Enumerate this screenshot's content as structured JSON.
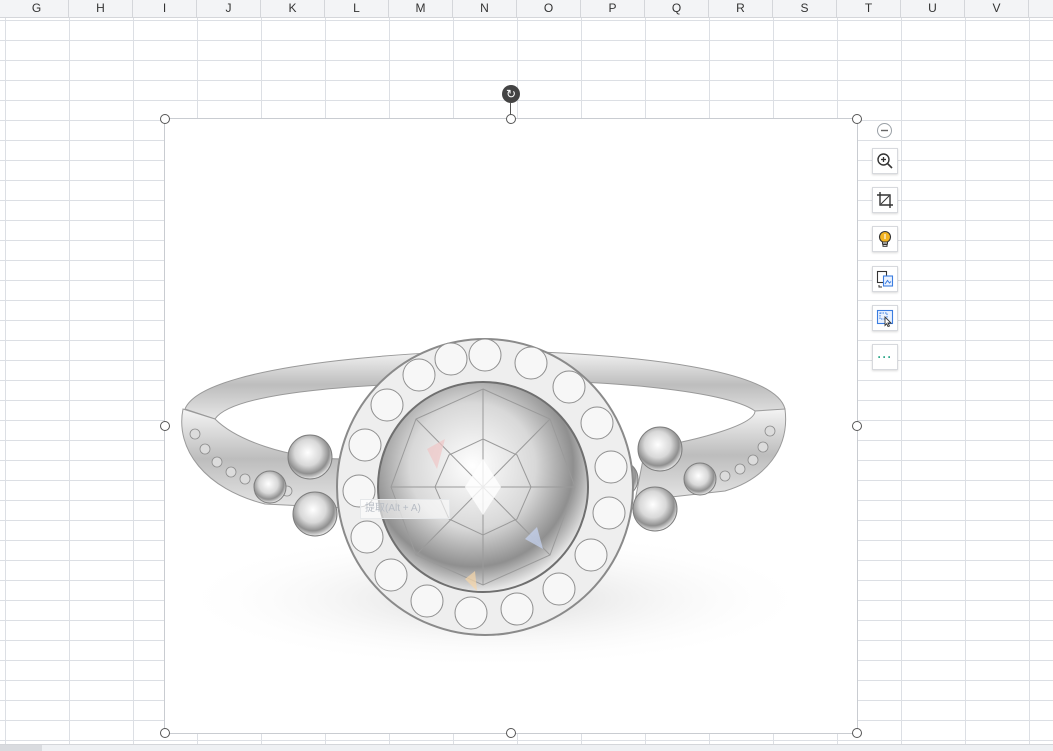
{
  "columns": [
    "G",
    "H",
    "I",
    "J",
    "K",
    "L",
    "M",
    "N",
    "O",
    "P",
    "Q",
    "R",
    "S",
    "T",
    "U",
    "V"
  ],
  "picture": {
    "description_icon": "ring-photo",
    "overlay_hint": "提取(Alt + A)"
  },
  "toolbar": {
    "collapse_icon": "minus-circle-icon",
    "buttons": [
      {
        "name": "zoom-in-icon"
      },
      {
        "name": "crop-icon"
      },
      {
        "name": "lightbulb-icon"
      },
      {
        "name": "image-convert-icon"
      },
      {
        "name": "image-select-icon"
      },
      {
        "name": "more-icon",
        "label": "···"
      }
    ]
  },
  "colors": {
    "accent": "#3b7de0",
    "more": "#2ea88a",
    "bulb": "#f2b321"
  }
}
